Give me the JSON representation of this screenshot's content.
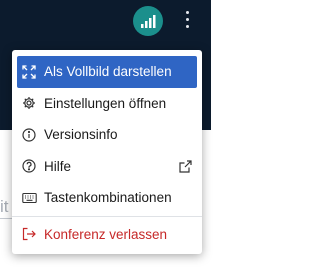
{
  "topbar": {
    "connection_icon": "signal-bars-icon",
    "more_icon": "more-vertical-icon"
  },
  "background": {
    "fragment_text": "it"
  },
  "menu": {
    "items": [
      {
        "label": "Als Vollbild darstellen",
        "icon": "fullscreen-icon",
        "highlighted": true
      },
      {
        "label": "Einstellungen öffnen",
        "icon": "gear-icon"
      },
      {
        "label": "Versionsinfo",
        "icon": "info-icon"
      },
      {
        "label": "Hilfe",
        "icon": "help-icon",
        "trailing_icon": "external-link-icon"
      },
      {
        "label": "Tastenkombinationen",
        "icon": "keyboard-icon"
      },
      {
        "label": "Konferenz verlassen",
        "icon": "logout-icon",
        "danger": true
      }
    ]
  },
  "colors": {
    "topbar_bg": "#0c1b2d",
    "connection_badge": "#1b8f8c",
    "highlight": "#2f65c4",
    "danger": "#c62828"
  }
}
